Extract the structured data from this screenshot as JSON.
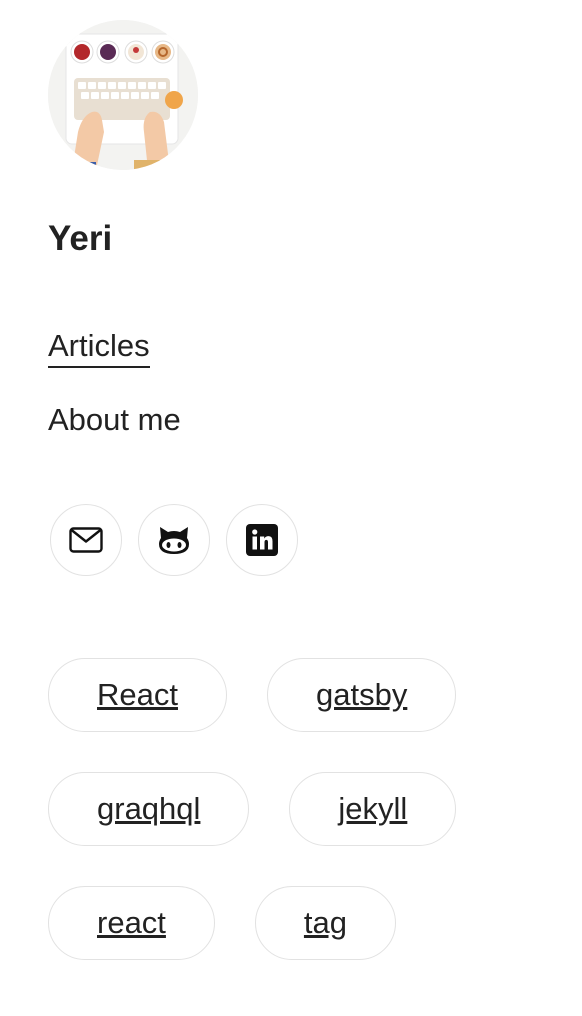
{
  "profile": {
    "name": "Yeri",
    "avatar": "avatar-photo-typewriter"
  },
  "nav": {
    "items": [
      {
        "label": "Articles",
        "active": true
      },
      {
        "label": "About me",
        "active": false
      }
    ]
  },
  "social": [
    {
      "icon": "mail-icon"
    },
    {
      "icon": "github-icon"
    },
    {
      "icon": "linkedin-icon"
    }
  ],
  "tags": [
    "React",
    "gatsby",
    "graqhql",
    "jekyll",
    "react",
    "tag"
  ],
  "colors": {
    "text": "#222222",
    "border": "#e2e2e2",
    "background": "#ffffff"
  }
}
